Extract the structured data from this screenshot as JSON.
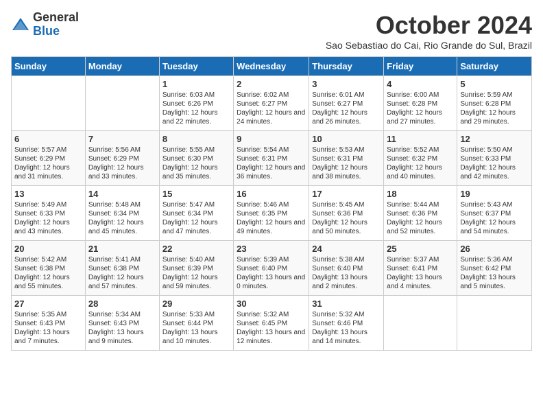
{
  "logo": {
    "general": "General",
    "blue": "Blue"
  },
  "title": "October 2024",
  "location": "Sao Sebastiao do Cai, Rio Grande do Sul, Brazil",
  "days": [
    "Sunday",
    "Monday",
    "Tuesday",
    "Wednesday",
    "Thursday",
    "Friday",
    "Saturday"
  ],
  "weeks": [
    [
      {
        "day": "",
        "info": ""
      },
      {
        "day": "",
        "info": ""
      },
      {
        "day": "1",
        "info": "Sunrise: 6:03 AM\nSunset: 6:26 PM\nDaylight: 12 hours and 22 minutes."
      },
      {
        "day": "2",
        "info": "Sunrise: 6:02 AM\nSunset: 6:27 PM\nDaylight: 12 hours and 24 minutes."
      },
      {
        "day": "3",
        "info": "Sunrise: 6:01 AM\nSunset: 6:27 PM\nDaylight: 12 hours and 26 minutes."
      },
      {
        "day": "4",
        "info": "Sunrise: 6:00 AM\nSunset: 6:28 PM\nDaylight: 12 hours and 27 minutes."
      },
      {
        "day": "5",
        "info": "Sunrise: 5:59 AM\nSunset: 6:28 PM\nDaylight: 12 hours and 29 minutes."
      }
    ],
    [
      {
        "day": "6",
        "info": "Sunrise: 5:57 AM\nSunset: 6:29 PM\nDaylight: 12 hours and 31 minutes."
      },
      {
        "day": "7",
        "info": "Sunrise: 5:56 AM\nSunset: 6:29 PM\nDaylight: 12 hours and 33 minutes."
      },
      {
        "day": "8",
        "info": "Sunrise: 5:55 AM\nSunset: 6:30 PM\nDaylight: 12 hours and 35 minutes."
      },
      {
        "day": "9",
        "info": "Sunrise: 5:54 AM\nSunset: 6:31 PM\nDaylight: 12 hours and 36 minutes."
      },
      {
        "day": "10",
        "info": "Sunrise: 5:53 AM\nSunset: 6:31 PM\nDaylight: 12 hours and 38 minutes."
      },
      {
        "day": "11",
        "info": "Sunrise: 5:52 AM\nSunset: 6:32 PM\nDaylight: 12 hours and 40 minutes."
      },
      {
        "day": "12",
        "info": "Sunrise: 5:50 AM\nSunset: 6:33 PM\nDaylight: 12 hours and 42 minutes."
      }
    ],
    [
      {
        "day": "13",
        "info": "Sunrise: 5:49 AM\nSunset: 6:33 PM\nDaylight: 12 hours and 43 minutes."
      },
      {
        "day": "14",
        "info": "Sunrise: 5:48 AM\nSunset: 6:34 PM\nDaylight: 12 hours and 45 minutes."
      },
      {
        "day": "15",
        "info": "Sunrise: 5:47 AM\nSunset: 6:34 PM\nDaylight: 12 hours and 47 minutes."
      },
      {
        "day": "16",
        "info": "Sunrise: 5:46 AM\nSunset: 6:35 PM\nDaylight: 12 hours and 49 minutes."
      },
      {
        "day": "17",
        "info": "Sunrise: 5:45 AM\nSunset: 6:36 PM\nDaylight: 12 hours and 50 minutes."
      },
      {
        "day": "18",
        "info": "Sunrise: 5:44 AM\nSunset: 6:36 PM\nDaylight: 12 hours and 52 minutes."
      },
      {
        "day": "19",
        "info": "Sunrise: 5:43 AM\nSunset: 6:37 PM\nDaylight: 12 hours and 54 minutes."
      }
    ],
    [
      {
        "day": "20",
        "info": "Sunrise: 5:42 AM\nSunset: 6:38 PM\nDaylight: 12 hours and 55 minutes."
      },
      {
        "day": "21",
        "info": "Sunrise: 5:41 AM\nSunset: 6:38 PM\nDaylight: 12 hours and 57 minutes."
      },
      {
        "day": "22",
        "info": "Sunrise: 5:40 AM\nSunset: 6:39 PM\nDaylight: 12 hours and 59 minutes."
      },
      {
        "day": "23",
        "info": "Sunrise: 5:39 AM\nSunset: 6:40 PM\nDaylight: 13 hours and 0 minutes."
      },
      {
        "day": "24",
        "info": "Sunrise: 5:38 AM\nSunset: 6:40 PM\nDaylight: 13 hours and 2 minutes."
      },
      {
        "day": "25",
        "info": "Sunrise: 5:37 AM\nSunset: 6:41 PM\nDaylight: 13 hours and 4 minutes."
      },
      {
        "day": "26",
        "info": "Sunrise: 5:36 AM\nSunset: 6:42 PM\nDaylight: 13 hours and 5 minutes."
      }
    ],
    [
      {
        "day": "27",
        "info": "Sunrise: 5:35 AM\nSunset: 6:43 PM\nDaylight: 13 hours and 7 minutes."
      },
      {
        "day": "28",
        "info": "Sunrise: 5:34 AM\nSunset: 6:43 PM\nDaylight: 13 hours and 9 minutes."
      },
      {
        "day": "29",
        "info": "Sunrise: 5:33 AM\nSunset: 6:44 PM\nDaylight: 13 hours and 10 minutes."
      },
      {
        "day": "30",
        "info": "Sunrise: 5:32 AM\nSunset: 6:45 PM\nDaylight: 13 hours and 12 minutes."
      },
      {
        "day": "31",
        "info": "Sunrise: 5:32 AM\nSunset: 6:46 PM\nDaylight: 13 hours and 14 minutes."
      },
      {
        "day": "",
        "info": ""
      },
      {
        "day": "",
        "info": ""
      }
    ]
  ]
}
